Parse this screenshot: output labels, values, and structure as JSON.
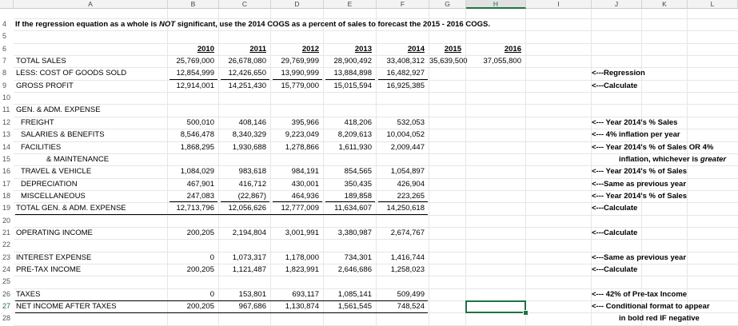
{
  "columns": [
    "A",
    "B",
    "C",
    "D",
    "E",
    "F",
    "G",
    "H",
    "I",
    "J",
    "K",
    "L"
  ],
  "selected_column": "H",
  "selected_row": "27",
  "rows": [
    "4",
    "5",
    "6",
    "7",
    "8",
    "9",
    "10",
    "11",
    "12",
    "13",
    "14",
    "15",
    "16",
    "17",
    "18",
    "19",
    "20",
    "21",
    "22",
    "23",
    "24",
    "25",
    "26",
    "27",
    "28"
  ],
  "instruction": {
    "prefix": "If the regression equation as a whole is ",
    "emphasis": "NOT",
    "suffix": " significant, use the 2014 COGS as a percent of sales to forecast the 2015 - 2016 COGS."
  },
  "years": [
    "2010",
    "2011",
    "2012",
    "2013",
    "2014",
    "2015",
    "2016"
  ],
  "labels": {
    "total_sales": "TOTAL SALES",
    "cogs": "LESS: COST OF GOODS SOLD",
    "gross_profit": "GROSS PROFIT",
    "gen_adm": "GEN. & ADM. EXPENSE",
    "freight": "FREIGHT",
    "salaries": "SALARIES & BENEFITS",
    "facilities": "FACILITIES",
    "maintenance": "& MAINTENANCE",
    "travel": "TRAVEL & VEHICLE",
    "depreciation": "DEPRECIATION",
    "misc": "MISCELLANEOUS",
    "total_gen_adm": "TOTAL GEN. & ADM. EXPENSE",
    "operating_income": "OPERATING INCOME",
    "interest": "INTEREST EXPENSE",
    "pretax": "PRE-TAX INCOME",
    "taxes": "TAXES",
    "net_income": "NET INCOME AFTER TAXES"
  },
  "values": {
    "total_sales": [
      "25,769,000",
      "26,678,080",
      "29,769,999",
      "28,900,492",
      "33,408,312",
      "35,639,500",
      "37,055,800"
    ],
    "cogs": [
      "12,854,999",
      "12,426,650",
      "13,990,999",
      "13,884,898",
      "16,482,927"
    ],
    "gross_profit": [
      "12,914,001",
      "14,251,430",
      "15,779,000",
      "15,015,594",
      "16,925,385"
    ],
    "freight": [
      "500,010",
      "408,146",
      "395,966",
      "418,206",
      "532,053"
    ],
    "salaries": [
      "8,546,478",
      "8,340,329",
      "9,223,049",
      "8,209,613",
      "10,004,052"
    ],
    "facilities": [
      "1,868,295",
      "1,930,688",
      "1,278,866",
      "1,611,930",
      "2,009,447"
    ],
    "travel": [
      "1,084,029",
      "983,618",
      "984,191",
      "854,565",
      "1,054,897"
    ],
    "depreciation": [
      "467,901",
      "416,712",
      "430,001",
      "350,435",
      "426,904"
    ],
    "misc": [
      "247,083",
      "(22,867)",
      "464,936",
      "189,858",
      "223,265"
    ],
    "total_gen_adm": [
      "12,713,796",
      "12,056,626",
      "12,777,009",
      "11,634,607",
      "14,250,618"
    ],
    "operating_income": [
      "200,205",
      "2,194,804",
      "3,001,991",
      "3,380,987",
      "2,674,767"
    ],
    "interest": [
      "0",
      "1,073,317",
      "1,178,000",
      "734,301",
      "1,416,744"
    ],
    "pretax": [
      "200,205",
      "1,121,487",
      "1,823,991",
      "2,646,686",
      "1,258,023"
    ],
    "taxes": [
      "0",
      "153,801",
      "693,117",
      "1,085,141",
      "509,499"
    ],
    "net_income": [
      "200,205",
      "967,686",
      "1,130,874",
      "1,561,545",
      "748,524"
    ]
  },
  "notes": {
    "cogs": "<---Regression",
    "gross_profit": "<---Calculate",
    "freight": "<--- Year 2014's % Sales",
    "salaries": "<--- 4% inflation per year",
    "facilities": "<--- Year 2014's % of Sales OR 4%",
    "facilities_2_prefix": "inflation, whichever is ",
    "facilities_2_emph": "greater",
    "travel": "<--- Year 2014's % of Sales",
    "depreciation": "<---Same as previous year",
    "misc": "<--- Year 2014's % of Sales",
    "total_gen_adm": "<---Calculate",
    "operating_income": "<---Calculate",
    "interest": "<---Same as previous year",
    "pretax": "<---Calculate",
    "taxes": "<--- 42% of Pre-tax Income",
    "net_income": "<--- Conditional format to appear",
    "net_income_2": "in bold red IF negative"
  }
}
